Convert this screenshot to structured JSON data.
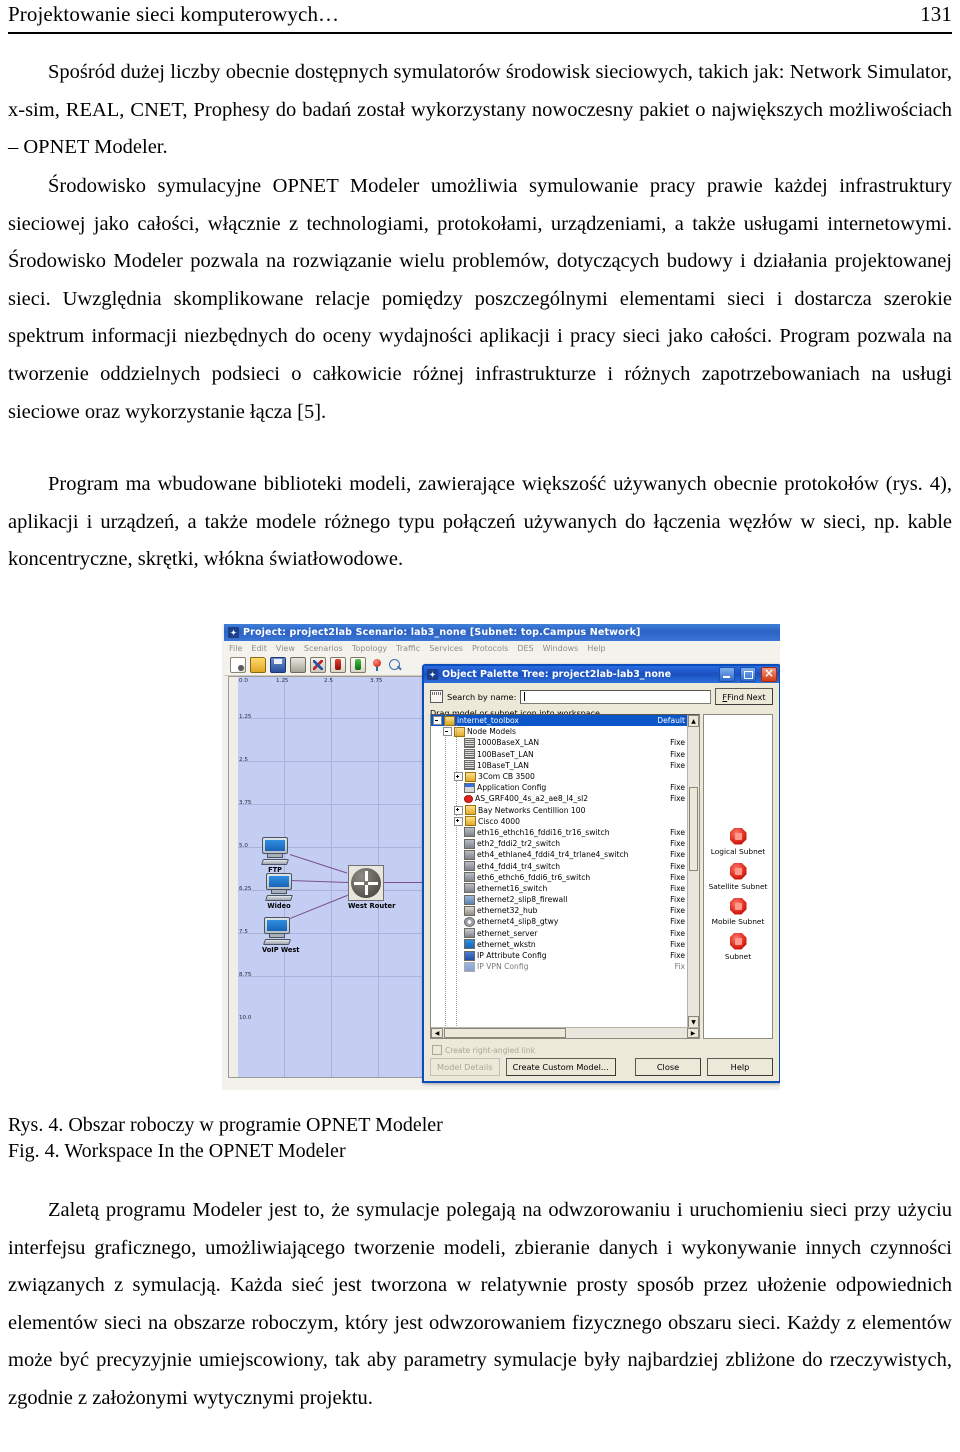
{
  "runhead": {
    "title": "Projektowanie sieci komputerowych…",
    "page": "131"
  },
  "paragraphs": {
    "p1": "Spośród dużej liczby obecnie dostępnych symulatorów środowisk sieciowych, takich jak: Network Simulator, x-sim, REAL, CNET, Prophesy do badań został wykorzystany nowoczesny pakiet o największych możliwościach – OPNET Modeler.",
    "p2": "Środowisko symulacyjne OPNET Modeler umożliwia symulowanie pracy prawie każdej infrastruktury sieciowej jako całości, włącznie z technologiami, protokołami, urządzeniami, a także usługami internetowymi. Środowisko Modeler pozwala na rozwiązanie wielu problemów, dotyczących budowy i działania projektowanej sieci. Uwzględnia skomplikowane relacje pomiędzy poszczególnymi elementami sieci i dostarcza szerokie spektrum informacji niezbędnych do oceny wydajności aplikacji i pracy sieci jako całości. Program pozwala na tworzenie oddzielnych podsieci o całkowicie różnej infrastrukturze i różnych zapotrzebowaniach na usługi sieciowe oraz wykorzystanie łącza [5].",
    "p3": "Program ma wbudowane biblioteki modeli, zawierające większość używanych obecnie protokołów (rys. 4), aplikacji i urządzeń, a także modele różnego typu połączeń używanych do łączenia węzłów w sieci, np. kable koncentryczne, skrętki, włókna światłowodowe.",
    "p4": "Zaletą programu Modeler jest to, że symulacje polegają na odwzorowaniu i uruchomieniu sieci przy użyciu interfejsu graficznego, umożliwiającego tworzenie modeli, zbieranie danych i wykonywanie innych czynności związanych z symulacją. Każda sieć jest tworzona w relatywnie prosty sposób przez ułożenie odpowiednich elementów sieci na obszarze roboczym, który jest odwzorowaniem fizycznego obszaru sieci. Każdy z elementów może być precyzyjnie umiejscowiony, tak aby parametry symulacje były najbardziej zbliżone do rzeczywistych, zgodnie z założonymi wytycznymi projektu."
  },
  "caption": {
    "pl": "Rys. 4. Obszar roboczy w programie OPNET Modeler",
    "en": "Fig. 4. Workspace In the OPNET Modeler"
  },
  "screenshot": {
    "main_window": {
      "title": "Project: project2lab Scenario: lab3_none  [Subnet: top.Campus Network]",
      "menu": [
        "File",
        "Edit",
        "View",
        "Scenarios",
        "Topology",
        "Traffic",
        "Services",
        "Protocols",
        "DES",
        "Windows",
        "Help"
      ],
      "toolbar_icons": [
        "new-scenario-icon",
        "open-icon",
        "save-icon",
        "print-icon",
        "check-links-icon",
        "configure-discrete-event-icon",
        "view-results-icon",
        "zoom-to-node-icon",
        "zoom-icon"
      ]
    },
    "workspace": {
      "x_ticks": [
        "0.0",
        "1.25",
        "2.5",
        "3.75"
      ],
      "y_ticks": [
        "1.25",
        "2.5",
        "3.75",
        "5.0",
        "6.25",
        "7.5",
        "8.75",
        "10.0"
      ],
      "nodes": [
        {
          "label": "FTP",
          "type": "workstation"
        },
        {
          "label": "Wideo",
          "type": "workstation"
        },
        {
          "label": "VoIP West",
          "type": "workstation"
        },
        {
          "label": "West Router",
          "type": "router"
        }
      ]
    },
    "dialog": {
      "title": "Object Palette Tree: project2lab-lab3_none",
      "window_buttons": [
        "minimize-button",
        "maximize-button",
        "close-button"
      ],
      "search_label": "Search by name:",
      "search_value": "",
      "find_next": "Find Next",
      "hint": "Drag model or subnet icon into workspace",
      "tree": [
        {
          "label": "internet_toolbox",
          "right": "Default",
          "indent": 0,
          "icon": "toolbox-icon",
          "selected": true,
          "expander": "minus"
        },
        {
          "label": "Node Models",
          "right": "",
          "indent": 1,
          "icon": "folder-open-icon",
          "expander": "minus"
        },
        {
          "label": "1000BaseX_LAN",
          "right": "Fixe",
          "indent": 2,
          "icon": "lan-icon",
          "expander": "none"
        },
        {
          "label": "100BaseT_LAN",
          "right": "Fixe",
          "indent": 2,
          "icon": "lan-icon",
          "expander": "none"
        },
        {
          "label": "10BaseT_LAN",
          "right": "Fixe",
          "indent": 2,
          "icon": "lan-icon",
          "expander": "none"
        },
        {
          "label": "3Com CB 3500",
          "right": "",
          "indent": 2,
          "icon": "folder-icon",
          "expander": "plus"
        },
        {
          "label": "Application Config",
          "right": "Fixe",
          "indent": 2,
          "icon": "application-config-icon",
          "expander": "none"
        },
        {
          "label": "AS_GRF400_4s_a2_ae8_l4_sl2",
          "right": "Fixe",
          "indent": 2,
          "icon": "router-red-icon",
          "expander": "none"
        },
        {
          "label": "Bay Networks Centillion 100",
          "right": "",
          "indent": 2,
          "icon": "folder-icon",
          "expander": "plus"
        },
        {
          "label": "Cisco 4000",
          "right": "",
          "indent": 2,
          "icon": "folder-icon",
          "expander": "plus"
        },
        {
          "label": "eth16_ethch16_fddi16_tr16_switch",
          "right": "Fixe",
          "indent": 2,
          "icon": "switch-icon",
          "expander": "none"
        },
        {
          "label": "eth2_fddi2_tr2_switch",
          "right": "Fixe",
          "indent": 2,
          "icon": "switch-icon",
          "expander": "none"
        },
        {
          "label": "eth4_ethlane4_fddi4_tr4_trlane4_switch",
          "right": "Fixe",
          "indent": 2,
          "icon": "switch-icon",
          "expander": "none"
        },
        {
          "label": "eth4_fddi4_tr4_switch",
          "right": "Fixe",
          "indent": 2,
          "icon": "switch-icon",
          "expander": "none"
        },
        {
          "label": "eth6_ethch6_fddi6_tr6_switch",
          "right": "Fixe",
          "indent": 2,
          "icon": "switch-icon",
          "expander": "none"
        },
        {
          "label": "ethernet16_switch",
          "right": "Fixe",
          "indent": 2,
          "icon": "switch-icon",
          "expander": "none"
        },
        {
          "label": "ethernet2_slip8_firewall",
          "right": "Fixe",
          "indent": 2,
          "icon": "firewall-icon",
          "expander": "none"
        },
        {
          "label": "ethernet32_hub",
          "right": "Fixe",
          "indent": 2,
          "icon": "hub-icon",
          "expander": "none"
        },
        {
          "label": "ethernet4_slip8_gtwy",
          "right": "Fixe",
          "indent": 2,
          "icon": "gateway-icon",
          "expander": "none"
        },
        {
          "label": "ethernet_server",
          "right": "Fixe",
          "indent": 2,
          "icon": "server-icon",
          "expander": "none"
        },
        {
          "label": "ethernet_wkstn",
          "right": "Fixe",
          "indent": 2,
          "icon": "workstation-icon",
          "expander": "none"
        },
        {
          "label": "IP Attribute Config",
          "right": "Fixe",
          "indent": 2,
          "icon": "config-icon",
          "expander": "none"
        },
        {
          "label": "IP VPN Config",
          "right": "Fix",
          "indent": 2,
          "icon": "config-icon",
          "expander": "none"
        }
      ],
      "subnets": [
        {
          "label": "Logical Subnet",
          "icon": "logical-subnet-icon"
        },
        {
          "label": "Satellite Subnet",
          "icon": "satellite-subnet-icon"
        },
        {
          "label": "Mobile Subnet",
          "icon": "mobile-subnet-icon"
        },
        {
          "label": "Subnet",
          "icon": "subnet-icon"
        }
      ],
      "checkbox_label": "Create right-angled link",
      "buttons": {
        "model_details": "Model Details",
        "create_custom_model": "Create Custom Model...",
        "close": "Close",
        "help": "Help"
      }
    }
  },
  "colors": {
    "title_blue": "#1a4fc0",
    "dialog_face": "#ece9d8",
    "canvas_blue": "#c4cdf2",
    "selection_blue": "#0a55c8",
    "subnet_red": "#d81f12"
  }
}
